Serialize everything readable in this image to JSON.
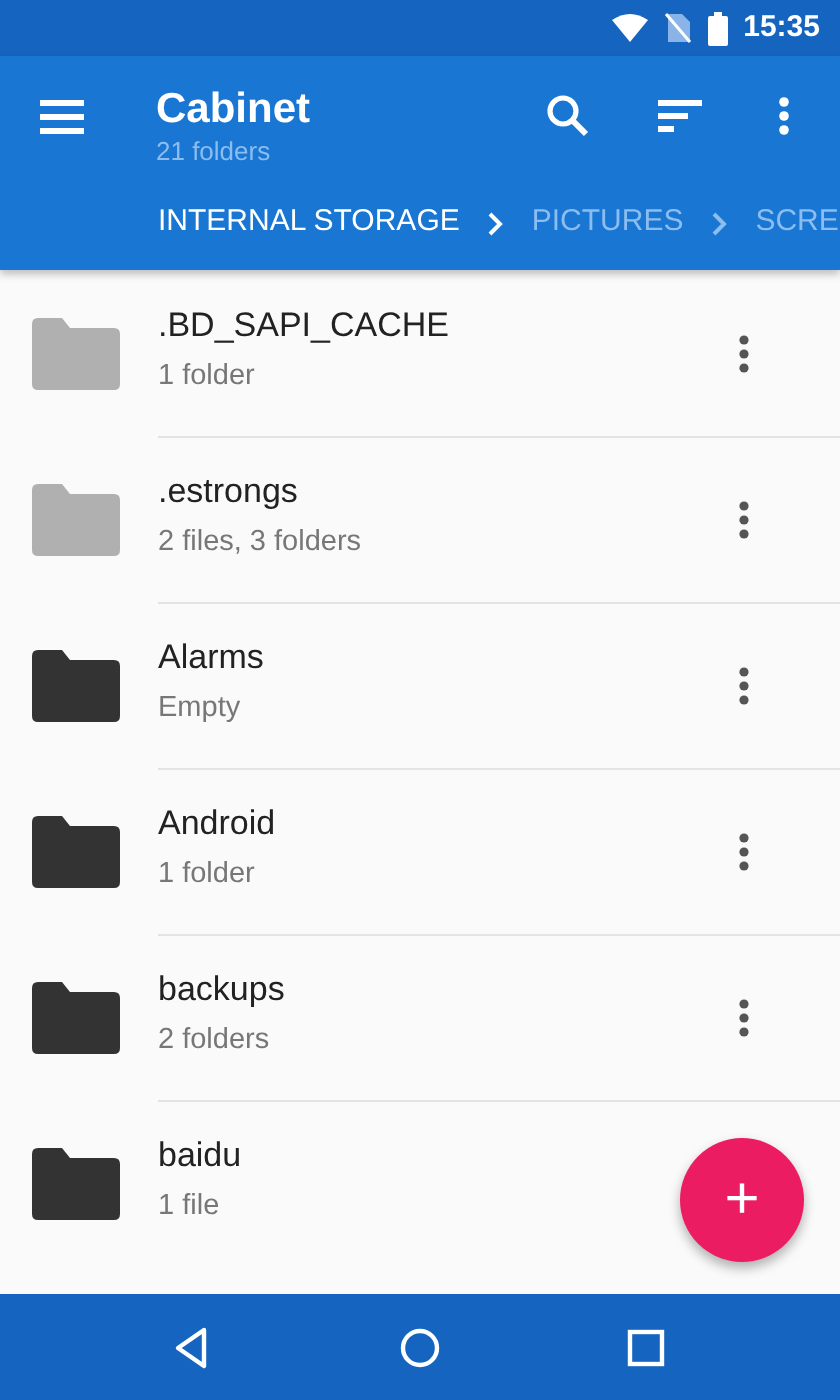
{
  "status_bar": {
    "time": "15:35"
  },
  "app_bar": {
    "title": "Cabinet",
    "subtitle": "21 folders"
  },
  "breadcrumbs": [
    {
      "label": "INTERNAL STORAGE",
      "selected": true
    },
    {
      "label": "PICTURES",
      "selected": false
    },
    {
      "label": "SCRE",
      "selected": false
    }
  ],
  "folders": [
    {
      "name": ".BD_SAPI_CACHE",
      "info": "1 folder",
      "hidden": true
    },
    {
      "name": ".estrongs",
      "info": "2 files, 3 folders",
      "hidden": true
    },
    {
      "name": "Alarms",
      "info": "Empty",
      "hidden": false
    },
    {
      "name": "Android",
      "info": "1 folder",
      "hidden": false
    },
    {
      "name": "backups",
      "info": "2 folders",
      "hidden": false
    },
    {
      "name": "baidu",
      "info": "1 file",
      "hidden": false
    }
  ],
  "fab": {
    "label": "+"
  }
}
